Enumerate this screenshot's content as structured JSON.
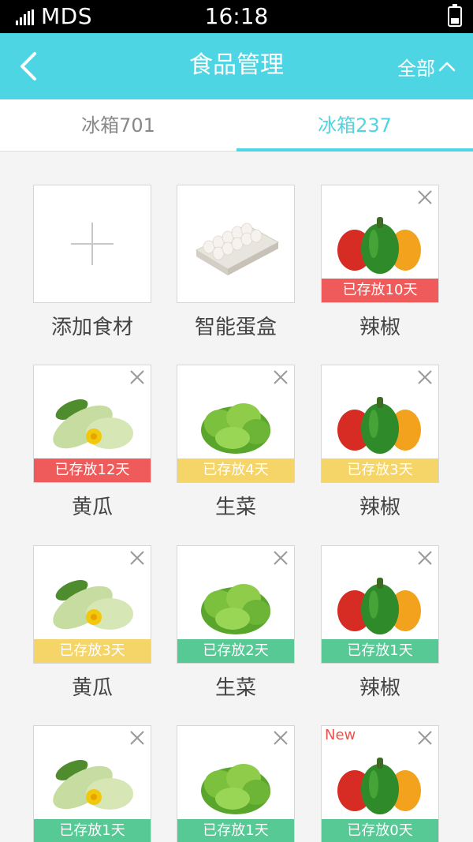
{
  "status_bar": {
    "carrier": "MDS",
    "time": "16:18"
  },
  "header": {
    "back_icon": "chevron-left-icon",
    "title": "食品管理",
    "filter_label": "全部",
    "filter_icon": "chevron-up-icon"
  },
  "tabs": [
    {
      "label": "冰箱701",
      "active": false
    },
    {
      "label": "冰箱237",
      "active": true
    }
  ],
  "colors": {
    "accent": "#4ed5e3",
    "badge_red": "#ef5b5b",
    "badge_yellow": "#f5d468",
    "badge_green": "#56c994",
    "new_text": "#e8554f"
  },
  "items": [
    {
      "name": "添加食材",
      "kind": "add",
      "icon": "plus-icon"
    },
    {
      "name": "智能蛋盒",
      "kind": "egg",
      "icon": "egg-tray-icon"
    },
    {
      "name": "辣椒",
      "kind": "pepper",
      "badge": "已存放10天",
      "badge_color": "red",
      "closable": true
    },
    {
      "name": "黄瓜",
      "kind": "cucumber",
      "badge": "已存放12天",
      "badge_color": "red",
      "closable": true
    },
    {
      "name": "生菜",
      "kind": "lettuce",
      "badge": "已存放4天",
      "badge_color": "yellow",
      "closable": true
    },
    {
      "name": "辣椒",
      "kind": "pepper",
      "badge": "已存放3天",
      "badge_color": "yellow",
      "closable": true
    },
    {
      "name": "黄瓜",
      "kind": "cucumber",
      "badge": "已存放3天",
      "badge_color": "yellow",
      "closable": true
    },
    {
      "name": "生菜",
      "kind": "lettuce",
      "badge": "已存放2天",
      "badge_color": "green",
      "closable": true
    },
    {
      "name": "辣椒",
      "kind": "pepper",
      "badge": "已存放1天",
      "badge_color": "green",
      "closable": true
    },
    {
      "name": "",
      "kind": "cucumber",
      "badge": "已存放1天",
      "badge_color": "green",
      "closable": true
    },
    {
      "name": "",
      "kind": "lettuce",
      "badge": "已存放1天",
      "badge_color": "green",
      "closable": true
    },
    {
      "name": "",
      "kind": "pepper",
      "badge": "已存放0天",
      "badge_color": "green",
      "closable": true,
      "new_label": "New"
    }
  ]
}
